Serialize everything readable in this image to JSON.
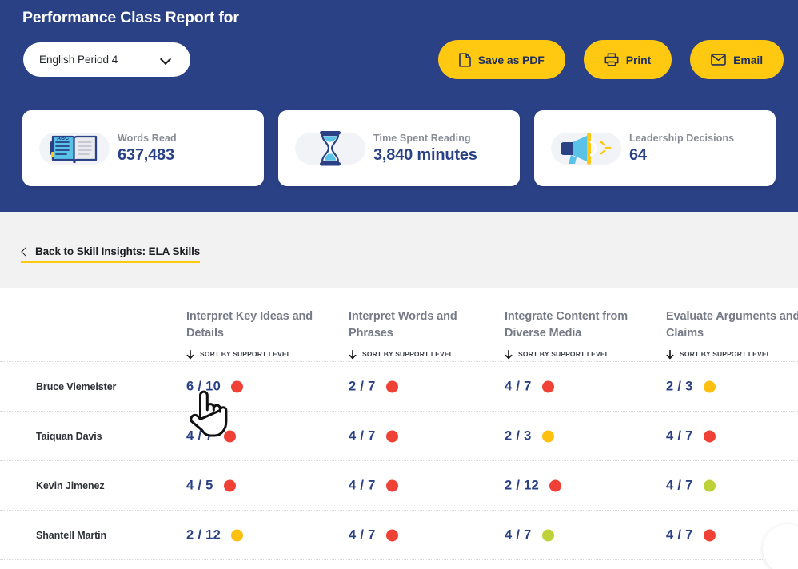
{
  "header": {
    "title": "Performance Class Report for",
    "class_select": {
      "value": "English Period 4",
      "icon": "chevron-down-icon"
    },
    "actions": [
      {
        "label": "Save as PDF",
        "icon": "file-document-icon"
      },
      {
        "label": "Print",
        "icon": "printer-icon"
      },
      {
        "label": "Email",
        "icon": "envelope-icon"
      }
    ],
    "background_color": "#2b4185",
    "button_color": "#ffc811"
  },
  "stats": [
    {
      "label": "Words Read",
      "value": "637,483",
      "icon": "open-book-icon"
    },
    {
      "label": "Time Spent Reading",
      "value": "3,840 minutes",
      "icon": "hourglass-icon"
    },
    {
      "label": "Leadership Decisions",
      "value": "64",
      "icon": "megaphone-icon"
    }
  ],
  "back_link": {
    "label": "Back to Skill Insights: ELA Skills",
    "icon": "chevron-left-icon",
    "underline_color": "#ffc811"
  },
  "table": {
    "sort_label": "SORT BY SUPPORT LEVEL",
    "sort_icon": "arrow-down-icon",
    "columns": [
      "Interpret Key Ideas and Details",
      "Interpret Words and Phrases",
      "Integrate Content from Diverse Media",
      "Evaluate Arguments and Claims"
    ],
    "legend_colors": {
      "red": "#ef4136",
      "yellow": "#fdc010",
      "green": "#bfd139"
    },
    "rows": [
      {
        "name": "Bruce Viemeister",
        "cells": [
          {
            "score": "6 / 10",
            "status": "red"
          },
          {
            "score": "2 / 7",
            "status": "red"
          },
          {
            "score": "4 / 7",
            "status": "red"
          },
          {
            "score": "2 / 3",
            "status": "yellow"
          }
        ]
      },
      {
        "name": "Taiquan Davis",
        "cells": [
          {
            "score": "4 / 7",
            "status": "red"
          },
          {
            "score": "4 / 7",
            "status": "red"
          },
          {
            "score": "2 / 3",
            "status": "yellow"
          },
          {
            "score": "4 / 7",
            "status": "red"
          }
        ]
      },
      {
        "name": "Kevin Jimenez",
        "cells": [
          {
            "score": "4 / 5",
            "status": "red"
          },
          {
            "score": "4 / 7",
            "status": "red"
          },
          {
            "score": "2 / 12",
            "status": "red"
          },
          {
            "score": "4 / 7",
            "status": "green"
          }
        ]
      },
      {
        "name": "Shantell Martin",
        "cells": [
          {
            "score": "2 / 12",
            "status": "yellow"
          },
          {
            "score": "4 / 7",
            "status": "red"
          },
          {
            "score": "4 / 7",
            "status": "green"
          },
          {
            "score": "4 / 7",
            "status": "red"
          }
        ]
      }
    ]
  },
  "cursor": {
    "icon": "pointing-hand-cursor"
  }
}
